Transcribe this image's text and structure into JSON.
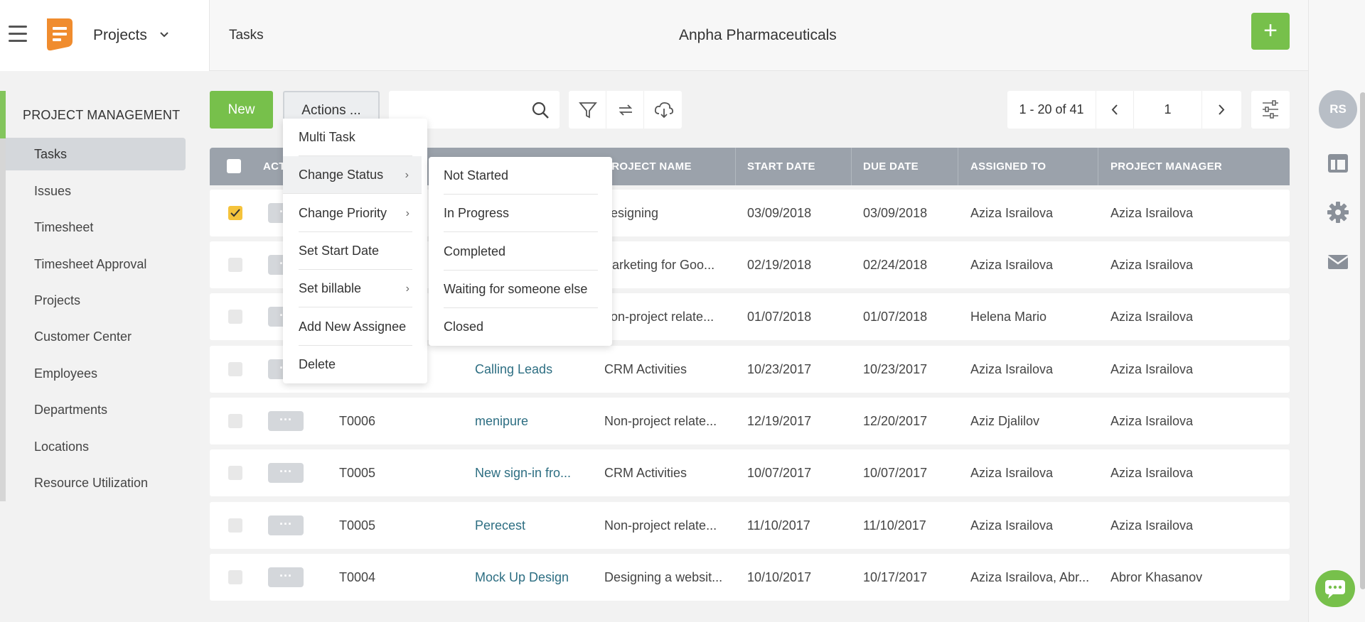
{
  "header": {
    "app_title": "Projects",
    "breadcrumb": "Tasks",
    "company": "Anpha Pharmaceuticals",
    "add_label": "+"
  },
  "sidebar": {
    "section": "PROJECT MANAGEMENT",
    "items": [
      {
        "label": "Tasks",
        "active": true
      },
      {
        "label": "Issues"
      },
      {
        "label": "Timesheet"
      },
      {
        "label": "Timesheet Approval"
      },
      {
        "label": "Projects"
      },
      {
        "label": "Customer Center"
      },
      {
        "label": "Employees"
      },
      {
        "label": "Departments"
      },
      {
        "label": "Locations"
      },
      {
        "label": "Resource Utilization"
      }
    ]
  },
  "toolbar": {
    "new_label": "New",
    "actions_label": "Actions ...",
    "search_placeholder": "",
    "pager_range": "1 - 20 of 41",
    "pager_page": "1"
  },
  "user": {
    "initials": "RS"
  },
  "table": {
    "columns": [
      "ACTI",
      "",
      "",
      "PROJECT NAME",
      "START DATE",
      "DUE DATE",
      "ASSIGNED TO",
      "PROJECT MANAGER"
    ],
    "rows": [
      {
        "checked": true,
        "id": "",
        "name": "",
        "project": "Designing",
        "start": "03/09/2018",
        "due": "03/09/2018",
        "assigned": "Aziza Israilova",
        "manager": "Aziza Israilova"
      },
      {
        "checked": false,
        "id": "",
        "name": "",
        "project": "Marketing for Goo...",
        "start": "02/19/2018",
        "due": "02/24/2018",
        "assigned": "Aziza Israilova",
        "manager": "Aziza Israilova"
      },
      {
        "checked": false,
        "id": "",
        "name": "",
        "project": "Non-project relate...",
        "start": "01/07/2018",
        "due": "01/07/2018",
        "assigned": "Helena Mario",
        "manager": "Aziza Israilova"
      },
      {
        "checked": false,
        "id": "",
        "name": "Calling Leads",
        "project": "CRM Activities",
        "start": "10/23/2017",
        "due": "10/23/2017",
        "assigned": "Aziza Israilova",
        "manager": "Aziza Israilova"
      },
      {
        "checked": false,
        "id": "T0006",
        "name": "menipure",
        "project": "Non-project relate...",
        "start": "12/19/2017",
        "due": "12/20/2017",
        "assigned": "Aziz Djalilov",
        "manager": "Aziza Israilova"
      },
      {
        "checked": false,
        "id": "T0005",
        "name": "New sign-in fro...",
        "project": "CRM Activities",
        "start": "10/07/2017",
        "due": "10/07/2017",
        "assigned": "Aziza Israilova",
        "manager": "Aziza Israilova"
      },
      {
        "checked": false,
        "id": "T0005",
        "name": "Perecest",
        "project": "Non-project relate...",
        "start": "11/10/2017",
        "due": "11/10/2017",
        "assigned": "Aziza Israilova",
        "manager": "Aziza Israilova"
      },
      {
        "checked": false,
        "id": "T0004",
        "name": "Mock Up Design",
        "project": "Designing a websit...",
        "start": "10/10/2017",
        "due": "10/17/2017",
        "assigned": "Aziza Israilova, Abr...",
        "manager": "Abror Khasanov"
      }
    ]
  },
  "actions_menu": {
    "items": [
      {
        "label": "Multi Task",
        "submenu": false
      },
      {
        "label": "Change Status",
        "submenu": true
      },
      {
        "label": "Change Priority",
        "submenu": true
      },
      {
        "label": "Set Start Date",
        "submenu": false
      },
      {
        "label": "Set billable",
        "submenu": true
      },
      {
        "label": "Add New Assignee",
        "submenu": false
      },
      {
        "label": "Delete",
        "submenu": false
      }
    ],
    "arrow": "›"
  },
  "status_submenu": {
    "items": [
      "Not Started",
      "In Progress",
      "Completed",
      "Waiting for someone else",
      "Closed"
    ]
  },
  "colors": {
    "accent": "#77c04b",
    "header_row": "#9ba2ab",
    "link": "#2d6e82",
    "checked": "#f5c33b"
  }
}
